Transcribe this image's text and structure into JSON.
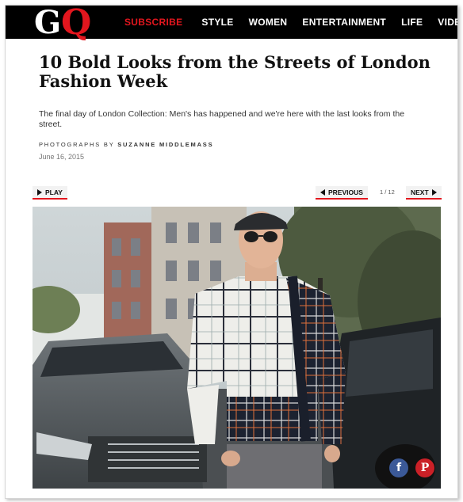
{
  "site": {
    "logo": {
      "g": "G",
      "q": "Q"
    },
    "nav": [
      {
        "label": "SUBSCRIBE"
      },
      {
        "label": "STYLE"
      },
      {
        "label": "WOMEN"
      },
      {
        "label": "ENTERTAINMENT"
      },
      {
        "label": "LIFE"
      },
      {
        "label": "VIDEO"
      }
    ],
    "brand_color": "#e3161e"
  },
  "article": {
    "title": "10 Bold Looks from the Streets of London Fashion Week",
    "dek": "The final day of London Collection: Men's has happened and we're here with the last looks from the street.",
    "credit_prefix": "PHOTOGRAPHS BY",
    "credit_name": "SUZANNE MIDDLEMASS",
    "date": "June 16, 2015"
  },
  "slideshow": {
    "play_label": "PLAY",
    "previous_label": "PREVIOUS",
    "counter": "1 / 12",
    "next_label": "NEXT",
    "current": 1,
    "total": 12
  },
  "share": {
    "facebook": "f",
    "pinterest": "P",
    "icons": [
      "facebook-icon",
      "pinterest-icon"
    ]
  }
}
